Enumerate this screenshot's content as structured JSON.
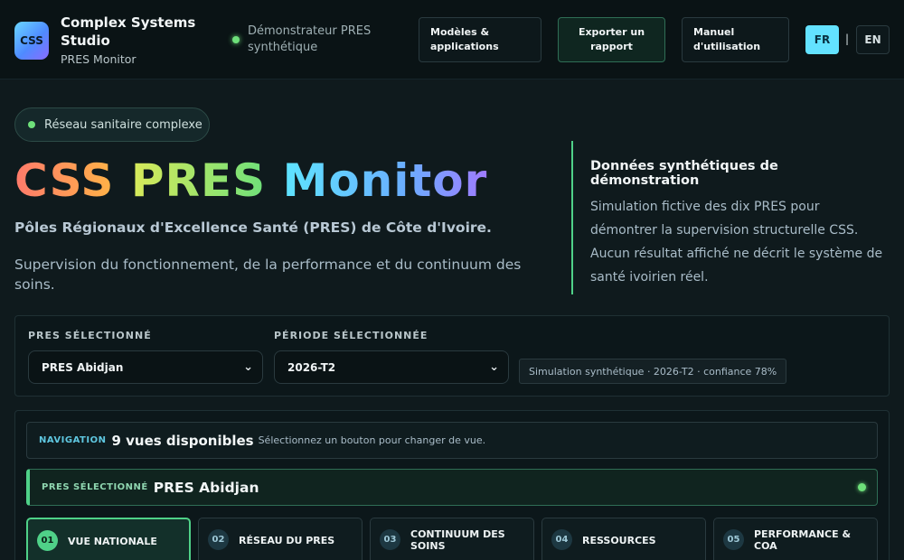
{
  "header": {
    "logo_text": "CSS",
    "brand_name": "Complex Systems Studio",
    "brand_sub": "PRES Monitor",
    "demo_label": "Démonstrateur PRES synthétique",
    "buttons": {
      "models": "Modèles & applications",
      "export": "Exporter un rapport",
      "manual": "Manuel d'utilisation"
    },
    "lang_fr": "FR",
    "lang_sep": "|",
    "lang_en": "EN"
  },
  "hero": {
    "pill": "Réseau sanitaire complexe",
    "title_part1": "CSS",
    "title_part2": "PRES",
    "title_part3": "Monitor",
    "subtitle": "Pôles Régionaux d'Excellence Santé (PRES) de Côte d'Ivoire.",
    "description": "Supervision du fonctionnement, de la performance et du continuum des soins.",
    "note_title": "Données synthétiques de démonstration",
    "note_body": "Simulation fictive des dix PRES pour démontrer la supervision structurelle CSS. Aucun résultat affiché ne décrit le système de santé ivoirien réel."
  },
  "selectors": {
    "pres_label": "PRES SÉLECTIONNÉ",
    "pres_value": "PRES Abidjan",
    "period_label": "PÉRIODE SÉLECTIONNÉE",
    "period_value": "2026-T2",
    "status": "Simulation synthétique · 2026-T2 · confiance 78%"
  },
  "navigation": {
    "key": "NAVIGATION",
    "count": "9 vues disponibles",
    "hint": "Sélectionnez un bouton pour changer de vue.",
    "selected_key": "PRES SÉLECTIONNÉ",
    "selected_value": "PRES Abidjan",
    "tabs": [
      {
        "num": "01",
        "label": "VUE NATIONALE"
      },
      {
        "num": "02",
        "label": "RÉSEAU DU PRES"
      },
      {
        "num": "03",
        "label": "CONTINUUM DES SOINS"
      },
      {
        "num": "04",
        "label": "RESSOURCES"
      },
      {
        "num": "05",
        "label": "PERFORMANCE & COA"
      }
    ]
  },
  "colors": {
    "accent_green": "#4fd188",
    "accent_cyan": "#63e2ff",
    "background": "#0f1a1d"
  }
}
